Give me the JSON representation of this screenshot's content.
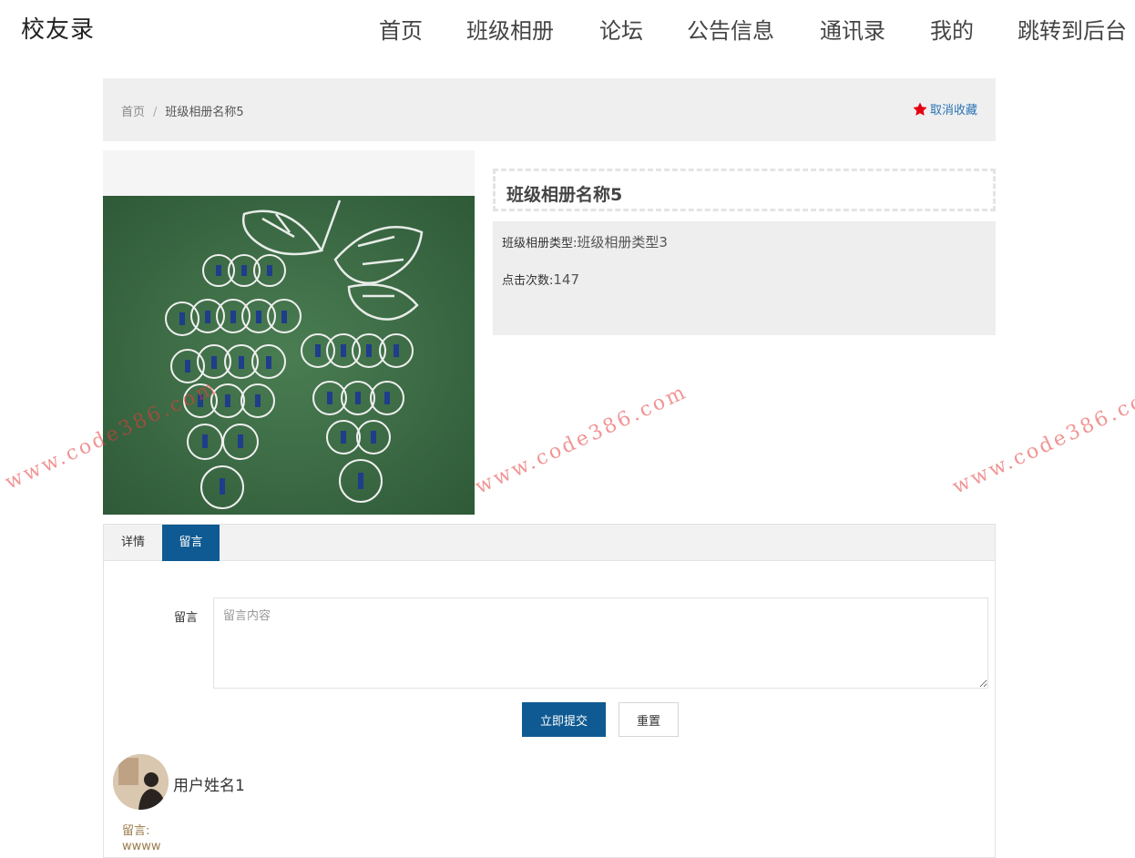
{
  "header": {
    "logo": "校友录",
    "nav": [
      {
        "label": "首页"
      },
      {
        "label": "班级相册"
      },
      {
        "label": "论坛"
      },
      {
        "label": "公告信息"
      },
      {
        "label": "通讯录"
      },
      {
        "label": "我的"
      },
      {
        "label": "跳转到后台"
      }
    ]
  },
  "breadcrumb": {
    "home": "首页",
    "separator": "/",
    "current": "班级相册名称5"
  },
  "favorite": {
    "label": "取消收藏",
    "icon": "star-icon",
    "icon_color": "#e60012"
  },
  "album": {
    "title": "班级相册名称5",
    "type_label": "班级相册类型:",
    "type_value": "班级相册类型3",
    "clicks_label": "点击次数:",
    "clicks_value": "147"
  },
  "tabs": [
    {
      "label": "详情",
      "active": false
    },
    {
      "label": "留言",
      "active": true
    }
  ],
  "message_form": {
    "label": "留言",
    "placeholder": "留言内容",
    "submit_label": "立即提交",
    "reset_label": "重置"
  },
  "comments": [
    {
      "user": "用户姓名1",
      "label": "留言:",
      "text": "wwww"
    }
  ],
  "watermark": "www.code386.com",
  "colors": {
    "accent": "#0f5a92",
    "link": "#2a73b5",
    "comment": "#9b7b4b",
    "watermark": "#e63c3c"
  }
}
